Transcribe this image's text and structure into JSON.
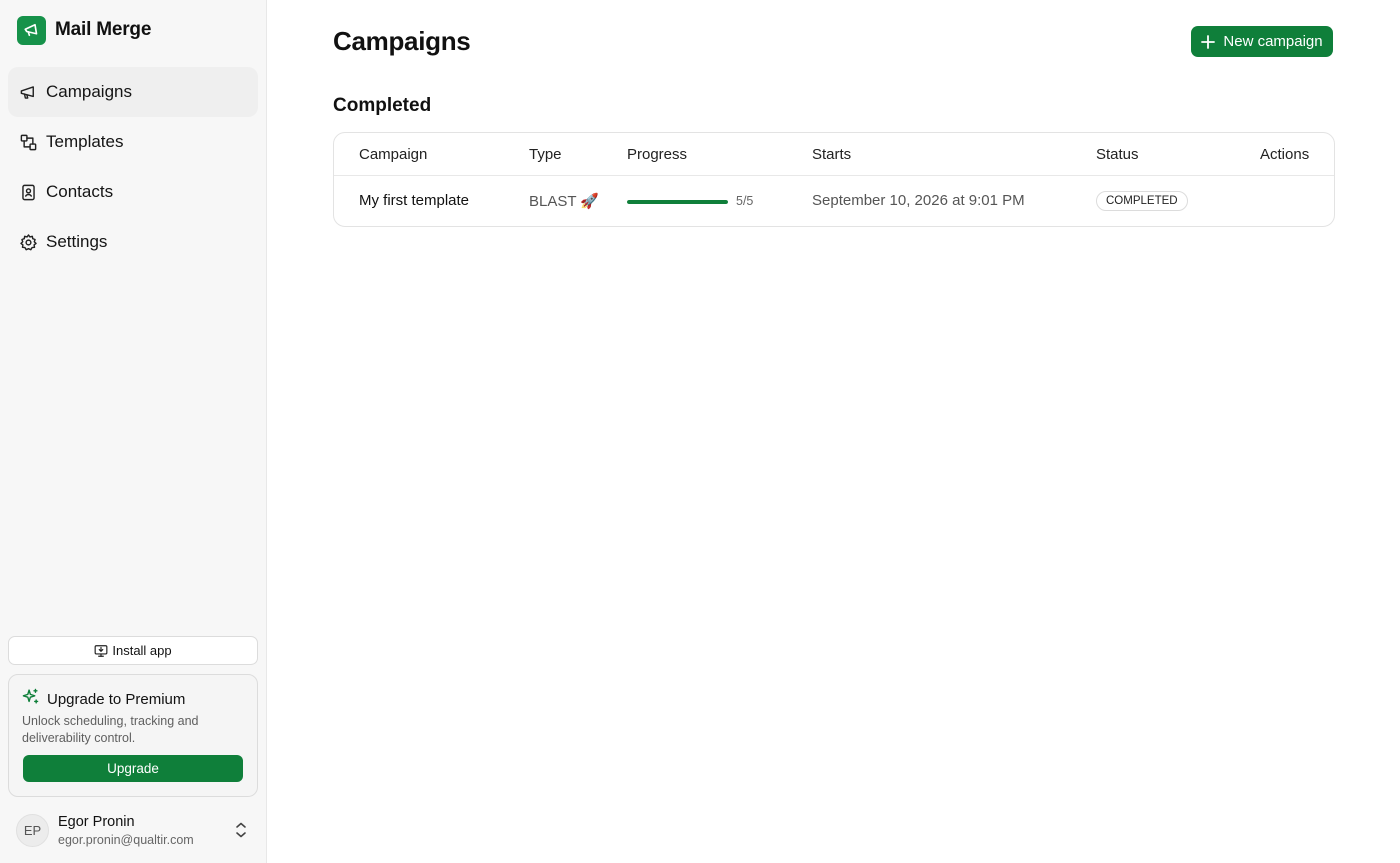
{
  "app": {
    "name": "Mail Merge",
    "logo_icon": "megaphone-icon",
    "accent": "#16924a"
  },
  "sidebar": {
    "items": [
      {
        "label": "Campaigns",
        "icon": "megaphone-icon",
        "active": true
      },
      {
        "label": "Templates",
        "icon": "templates-icon",
        "active": false
      },
      {
        "label": "Contacts",
        "icon": "contact-book-icon",
        "active": false
      },
      {
        "label": "Settings",
        "icon": "gear-icon",
        "active": false
      }
    ],
    "install_label": "Install app",
    "upgrade": {
      "title": "Upgrade to Premium",
      "description": "Unlock scheduling, tracking and deliverability control.",
      "button_label": "Upgrade"
    },
    "user": {
      "initials": "EP",
      "name": "Egor Pronin",
      "email": "egor.pronin@qualtir.com"
    }
  },
  "main": {
    "title": "Campaigns",
    "new_button_label": "New campaign",
    "section_title": "Completed",
    "table": {
      "columns": [
        "Campaign",
        "Type",
        "Progress",
        "Starts",
        "Status",
        "Actions"
      ],
      "rows": [
        {
          "campaign": "My first template",
          "type": "BLAST 🚀",
          "progress": {
            "done": 5,
            "total": 5,
            "label": "5/5",
            "fraction": 1.0
          },
          "starts": "September 10, 2026 at 9:01 PM",
          "status": "COMPLETED"
        }
      ]
    }
  },
  "colors": {
    "primary_button": "#0f7f3a",
    "progress_fill": "#0f7f3a"
  }
}
